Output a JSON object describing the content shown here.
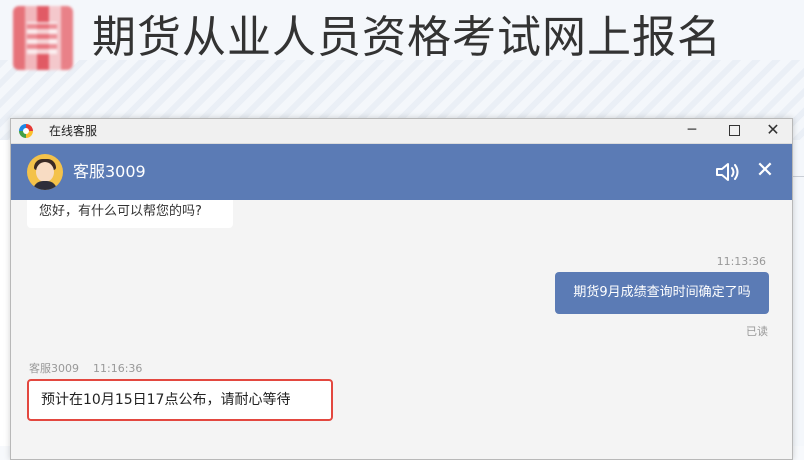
{
  "page": {
    "title": "期货从业人员资格考试网上报名"
  },
  "window": {
    "title": "在线客服",
    "controls": {
      "minimize": "─",
      "close": "✕"
    }
  },
  "chat_header": {
    "agent_name": "客服3009",
    "icons": [
      "avatar",
      "speaker-icon",
      "close-icon"
    ],
    "close_glyph": "✕",
    "color": "#5b7bb5"
  },
  "messages": [
    {
      "from": "agent",
      "text": "您好，有什么可以帮您的吗?"
    },
    {
      "from": "user",
      "time": "11:13:36",
      "text": "期货9月成绩查询时间确定了吗",
      "status": "已读"
    },
    {
      "from": "agent",
      "sender": "客服3009",
      "time": "11:16:36",
      "text": "预计在10月15日17点公布，请耐心等待",
      "highlight_color": "#e3473f"
    }
  ]
}
